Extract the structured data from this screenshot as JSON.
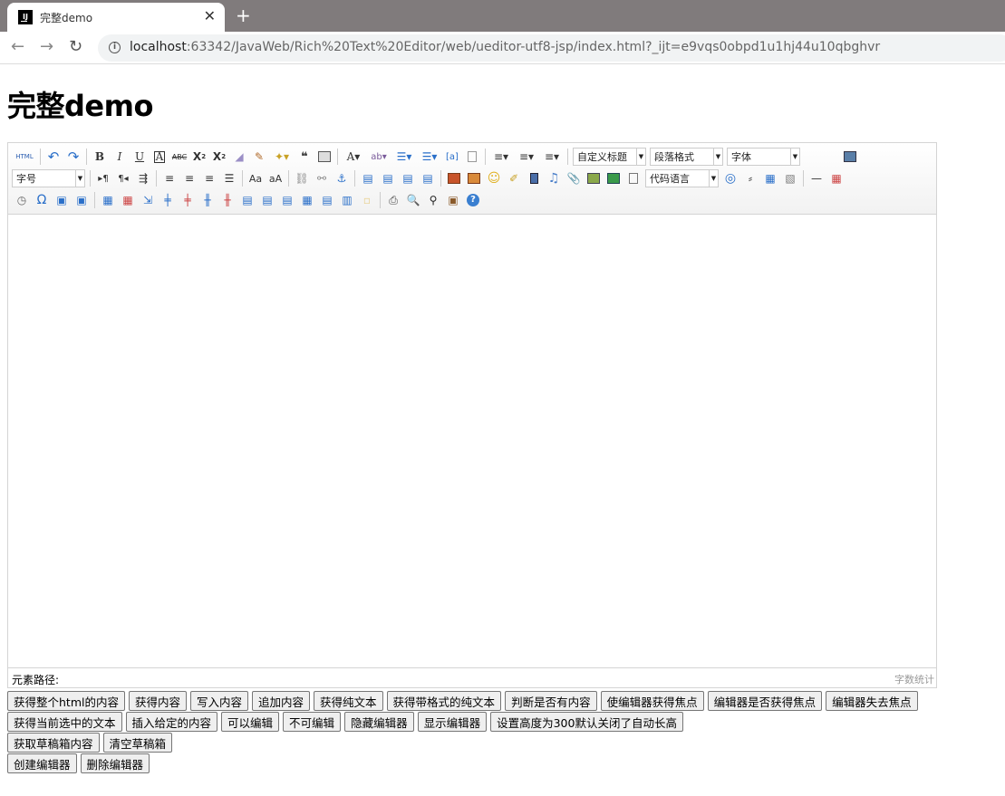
{
  "browser": {
    "tab_title": "完整demo",
    "url_host": "localhost",
    "url_rest": ":63342/JavaWeb/Rich%20Text%20Editor/web/ueditor-utf8-jsp/index.html?_ijt=e9vqs0obpd1u1hj44u10qbghvr"
  },
  "page": {
    "title": "完整demo"
  },
  "editor": {
    "html_label": "HTML",
    "combos": {
      "custom_title": "自定义标题",
      "paragraph": "段落格式",
      "font_family": "字体",
      "font_size": "字号",
      "code_lang": "代码语言"
    },
    "status_path_label": "元素路径:",
    "word_count_label": "字数统计"
  },
  "buttons": {
    "row1": [
      "获得整个html的内容",
      "获得内容",
      "写入内容",
      "追加内容",
      "获得纯文本",
      "获得带格式的纯文本",
      "判断是否有内容",
      "使编辑器获得焦点",
      "编辑器是否获得焦点",
      "编辑器失去焦点"
    ],
    "row2": [
      "获得当前选中的文本",
      "插入给定的内容",
      "可以编辑",
      "不可编辑",
      "隐藏编辑器",
      "显示编辑器",
      "设置高度为300默认关闭了自动长高"
    ],
    "row3": [
      "获取草稿箱内容",
      "清空草稿箱"
    ],
    "row4": [
      "创建编辑器",
      "删除编辑器"
    ]
  }
}
